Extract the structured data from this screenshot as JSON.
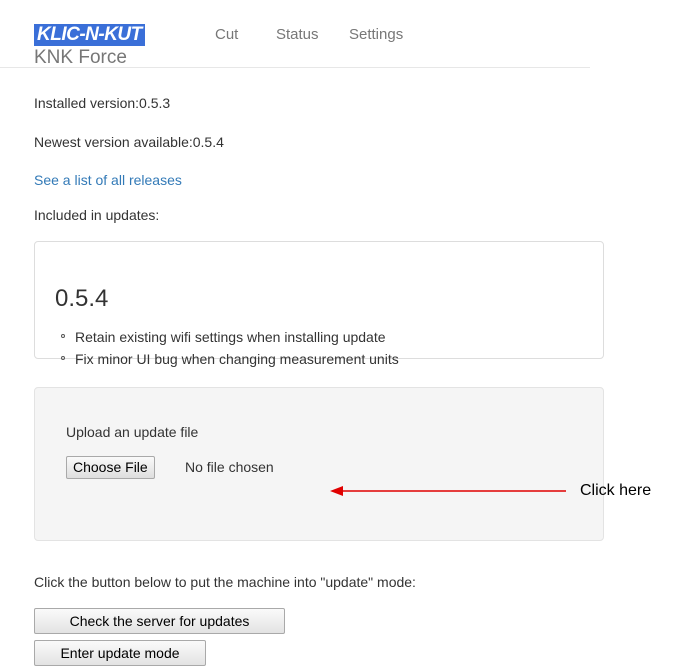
{
  "navbar": {
    "logo_text": "KLIC-N-KUT",
    "brand_name": "KNK Force",
    "links": [
      "Cut",
      "Status",
      "Settings"
    ]
  },
  "info": {
    "installed": "Installed version:0.5.3",
    "newest": "Newest version available:0.5.4",
    "releases_link": "See a list of all releases",
    "included": "Included in updates:"
  },
  "release": {
    "version": "0.5.4",
    "notes": [
      "Retain existing wifi settings when installing update",
      "Fix minor UI bug when changing measurement units"
    ]
  },
  "upload": {
    "label": "Upload an update file",
    "button_label": "Choose File",
    "status": "No file chosen"
  },
  "annotation": {
    "text": "Click here",
    "color": "#e00000"
  },
  "update": {
    "instruction": "Click the button below to put the machine into \"update\" mode:",
    "check_button": "Check the server for updates",
    "enter_button": "Enter update mode"
  },
  "colors": {
    "link": "#337ab7",
    "logo_background": "#3a6fd8"
  }
}
